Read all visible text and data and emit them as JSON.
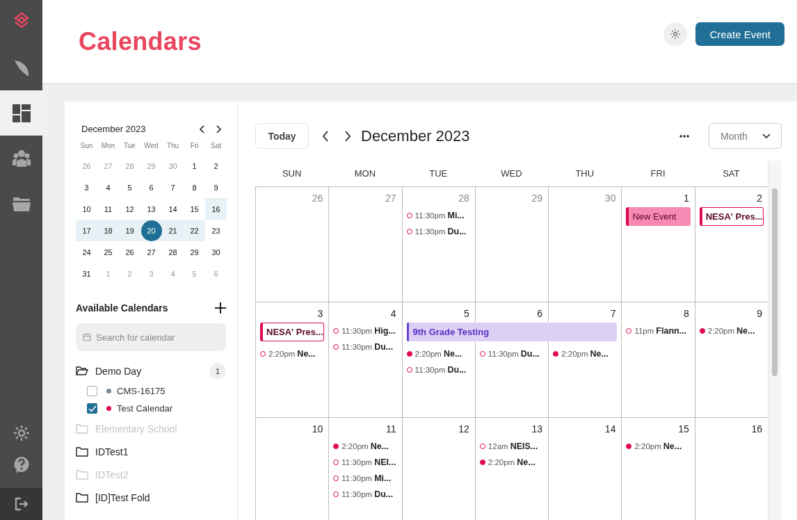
{
  "nav": {
    "items": [
      {
        "selected": false
      },
      {
        "selected": true
      },
      {
        "selected": false
      },
      {
        "selected": false
      }
    ]
  },
  "header": {
    "title": "Calendars",
    "create_button": "Create Event"
  },
  "mini_calendar": {
    "title": "December 2023",
    "weekdays": [
      "Sun",
      "Mon",
      "Tue",
      "Wed",
      "Thu",
      "Fri",
      "Sat"
    ],
    "weeks": [
      [
        {
          "label": "26",
          "muted": true,
          "in_range": false,
          "selected": false
        },
        {
          "label": "27",
          "muted": true,
          "in_range": false,
          "selected": false
        },
        {
          "label": "28",
          "muted": true,
          "in_range": false,
          "selected": false
        },
        {
          "label": "29",
          "muted": true,
          "in_range": false,
          "selected": false
        },
        {
          "label": "30",
          "muted": true,
          "in_range": false,
          "selected": false
        },
        {
          "label": "1",
          "muted": false,
          "in_range": false,
          "selected": false
        },
        {
          "label": "2",
          "muted": false,
          "in_range": false,
          "selected": false
        }
      ],
      [
        {
          "label": "3",
          "muted": false,
          "in_range": false,
          "selected": false
        },
        {
          "label": "4",
          "muted": false,
          "in_range": false,
          "selected": false
        },
        {
          "label": "5",
          "muted": false,
          "in_range": false,
          "selected": false
        },
        {
          "label": "6",
          "muted": false,
          "in_range": false,
          "selected": false
        },
        {
          "label": "7",
          "muted": false,
          "in_range": false,
          "selected": false
        },
        {
          "label": "8",
          "muted": false,
          "in_range": false,
          "selected": false
        },
        {
          "label": "9",
          "muted": false,
          "in_range": false,
          "selected": false
        }
      ],
      [
        {
          "label": "10",
          "muted": false,
          "in_range": false,
          "selected": false
        },
        {
          "label": "11",
          "muted": false,
          "in_range": false,
          "selected": false
        },
        {
          "label": "12",
          "muted": false,
          "in_range": false,
          "selected": false
        },
        {
          "label": "13",
          "muted": false,
          "in_range": false,
          "selected": false
        },
        {
          "label": "14",
          "muted": false,
          "in_range": false,
          "selected": false
        },
        {
          "label": "15",
          "muted": false,
          "in_range": false,
          "selected": false
        },
        {
          "label": "16",
          "muted": false,
          "in_range": true,
          "selected": false
        }
      ],
      [
        {
          "label": "17",
          "muted": false,
          "in_range": true,
          "selected": false
        },
        {
          "label": "18",
          "muted": false,
          "in_range": true,
          "selected": false
        },
        {
          "label": "19",
          "muted": false,
          "in_range": true,
          "selected": false
        },
        {
          "label": "20",
          "muted": false,
          "in_range": true,
          "selected": true
        },
        {
          "label": "21",
          "muted": false,
          "in_range": true,
          "selected": false
        },
        {
          "label": "22",
          "muted": false,
          "in_range": true,
          "selected": false
        },
        {
          "label": "23",
          "muted": false,
          "in_range": false,
          "selected": false
        }
      ],
      [
        {
          "label": "24",
          "muted": false,
          "in_range": false,
          "selected": false
        },
        {
          "label": "25",
          "muted": false,
          "in_range": false,
          "selected": false
        },
        {
          "label": "26",
          "muted": false,
          "in_range": false,
          "selected": false
        },
        {
          "label": "27",
          "muted": false,
          "in_range": false,
          "selected": false
        },
        {
          "label": "28",
          "muted": false,
          "in_range": false,
          "selected": false
        },
        {
          "label": "29",
          "muted": false,
          "in_range": false,
          "selected": false
        },
        {
          "label": "30",
          "muted": false,
          "in_range": false,
          "selected": false
        }
      ],
      [
        {
          "label": "31",
          "muted": false,
          "in_range": false,
          "selected": false
        },
        {
          "label": "1",
          "muted": true,
          "in_range": false,
          "selected": false
        },
        {
          "label": "2",
          "muted": true,
          "in_range": false,
          "selected": false
        },
        {
          "label": "3",
          "muted": true,
          "in_range": false,
          "selected": false
        },
        {
          "label": "4",
          "muted": true,
          "in_range": false,
          "selected": false
        },
        {
          "label": "5",
          "muted": true,
          "in_range": false,
          "selected": false
        },
        {
          "label": "6",
          "muted": true,
          "in_range": false,
          "selected": false
        }
      ]
    ]
  },
  "calendars": {
    "title": "Available Calendars",
    "search_placeholder": "Search for calendar",
    "folders": [
      {
        "name": "Demo Day",
        "expanded": true,
        "disabled": false,
        "count": "1",
        "children": [
          {
            "name": "CMS-16175",
            "checked": false,
            "color": "#7d8799"
          },
          {
            "name": "Test Calendar",
            "checked": true,
            "color": "#e0094f"
          }
        ]
      },
      {
        "name": "Elementary School",
        "expanded": false,
        "disabled": true
      },
      {
        "name": "IDTest1",
        "expanded": false,
        "disabled": false
      },
      {
        "name": "IDTest2",
        "expanded": false,
        "disabled": true
      },
      {
        "name": "[ID]Test Fold",
        "expanded": false,
        "disabled": false
      }
    ]
  },
  "toolbar": {
    "today": "Today",
    "title": "December 2023",
    "view": "Month"
  },
  "month": {
    "weekdays": [
      "SUN",
      "MON",
      "TUE",
      "WED",
      "THU",
      "FRI",
      "SAT"
    ],
    "weeks": [
      {
        "days": [
          {
            "date": "26",
            "muted": true
          },
          {
            "date": "27",
            "muted": true
          },
          {
            "date": "28",
            "muted": true,
            "events": [
              {
                "kind": "timed",
                "time": "11:30pm",
                "title": "Mi...",
                "filled": false
              },
              {
                "kind": "timed",
                "time": "11:30pm",
                "title": "Du...",
                "filled": false
              }
            ]
          },
          {
            "date": "29",
            "muted": true
          },
          {
            "date": "30",
            "muted": true
          },
          {
            "date": "1",
            "muted": false,
            "events": [
              {
                "kind": "filled-chip",
                "title": "New Event"
              }
            ]
          },
          {
            "date": "2",
            "muted": false,
            "events": [
              {
                "kind": "outlined-chip",
                "title": "NESA' Pres..."
              }
            ]
          }
        ]
      },
      {
        "days": [
          {
            "date": "3",
            "muted": false,
            "events": [
              {
                "kind": "outlined-chip",
                "title": "NESA' Pres..."
              },
              {
                "kind": "timed",
                "time": "2:20pm",
                "title": "Ne...",
                "filled": false
              }
            ]
          },
          {
            "date": "4",
            "muted": false,
            "events": [
              {
                "kind": "timed",
                "time": "11:30pm",
                "title": "Hig...",
                "filled": false
              },
              {
                "kind": "timed",
                "time": "11:30pm",
                "title": "Du...",
                "filled": false
              }
            ]
          },
          {
            "date": "5",
            "muted": false,
            "events": [
              {
                "kind": "banner",
                "title": "9th Grade Testing"
              },
              {
                "kind": "timed",
                "time": "2:20pm",
                "title": "Ne...",
                "filled": true
              },
              {
                "kind": "timed",
                "time": "11:30pm",
                "title": "Du...",
                "filled": false
              }
            ]
          },
          {
            "date": "6",
            "muted": false,
            "events": [
              {
                "kind": "banner-cont"
              },
              {
                "kind": "timed",
                "time": "11:30pm",
                "title": "Du...",
                "filled": false
              }
            ]
          },
          {
            "date": "7",
            "muted": false,
            "events": [
              {
                "kind": "banner-cont"
              },
              {
                "kind": "timed",
                "time": "2:20pm",
                "title": "Ne...",
                "filled": true
              }
            ]
          },
          {
            "date": "8",
            "muted": false,
            "events": [
              {
                "kind": "timed",
                "time": "11pm",
                "title": "Flann...",
                "filled": false
              }
            ]
          },
          {
            "date": "9",
            "muted": false,
            "events": [
              {
                "kind": "timed",
                "time": "2:20pm",
                "title": "Ne...",
                "filled": true
              }
            ]
          }
        ]
      },
      {
        "days": [
          {
            "date": "10",
            "muted": false
          },
          {
            "date": "11",
            "muted": false,
            "events": [
              {
                "kind": "timed",
                "time": "2:20pm",
                "title": "Ne...",
                "filled": true
              },
              {
                "kind": "timed",
                "time": "11:30pm",
                "title": "NEI...",
                "filled": false
              },
              {
                "kind": "timed",
                "time": "11:30pm",
                "title": "Mi...",
                "filled": false
              },
              {
                "kind": "timed",
                "time": "11:30pm",
                "title": "Du...",
                "filled": false
              }
            ]
          },
          {
            "date": "12",
            "muted": false
          },
          {
            "date": "13",
            "muted": false,
            "events": [
              {
                "kind": "timed",
                "time": "12am",
                "title": "NEIS...",
                "filled": false
              },
              {
                "kind": "timed",
                "time": "2:20pm",
                "title": "Ne...",
                "filled": true
              }
            ]
          },
          {
            "date": "14",
            "muted": false
          },
          {
            "date": "15",
            "muted": false,
            "events": [
              {
                "kind": "timed",
                "time": "2:20pm",
                "title": "Ne...",
                "filled": true
              }
            ]
          },
          {
            "date": "16",
            "muted": false
          }
        ]
      }
    ]
  }
}
